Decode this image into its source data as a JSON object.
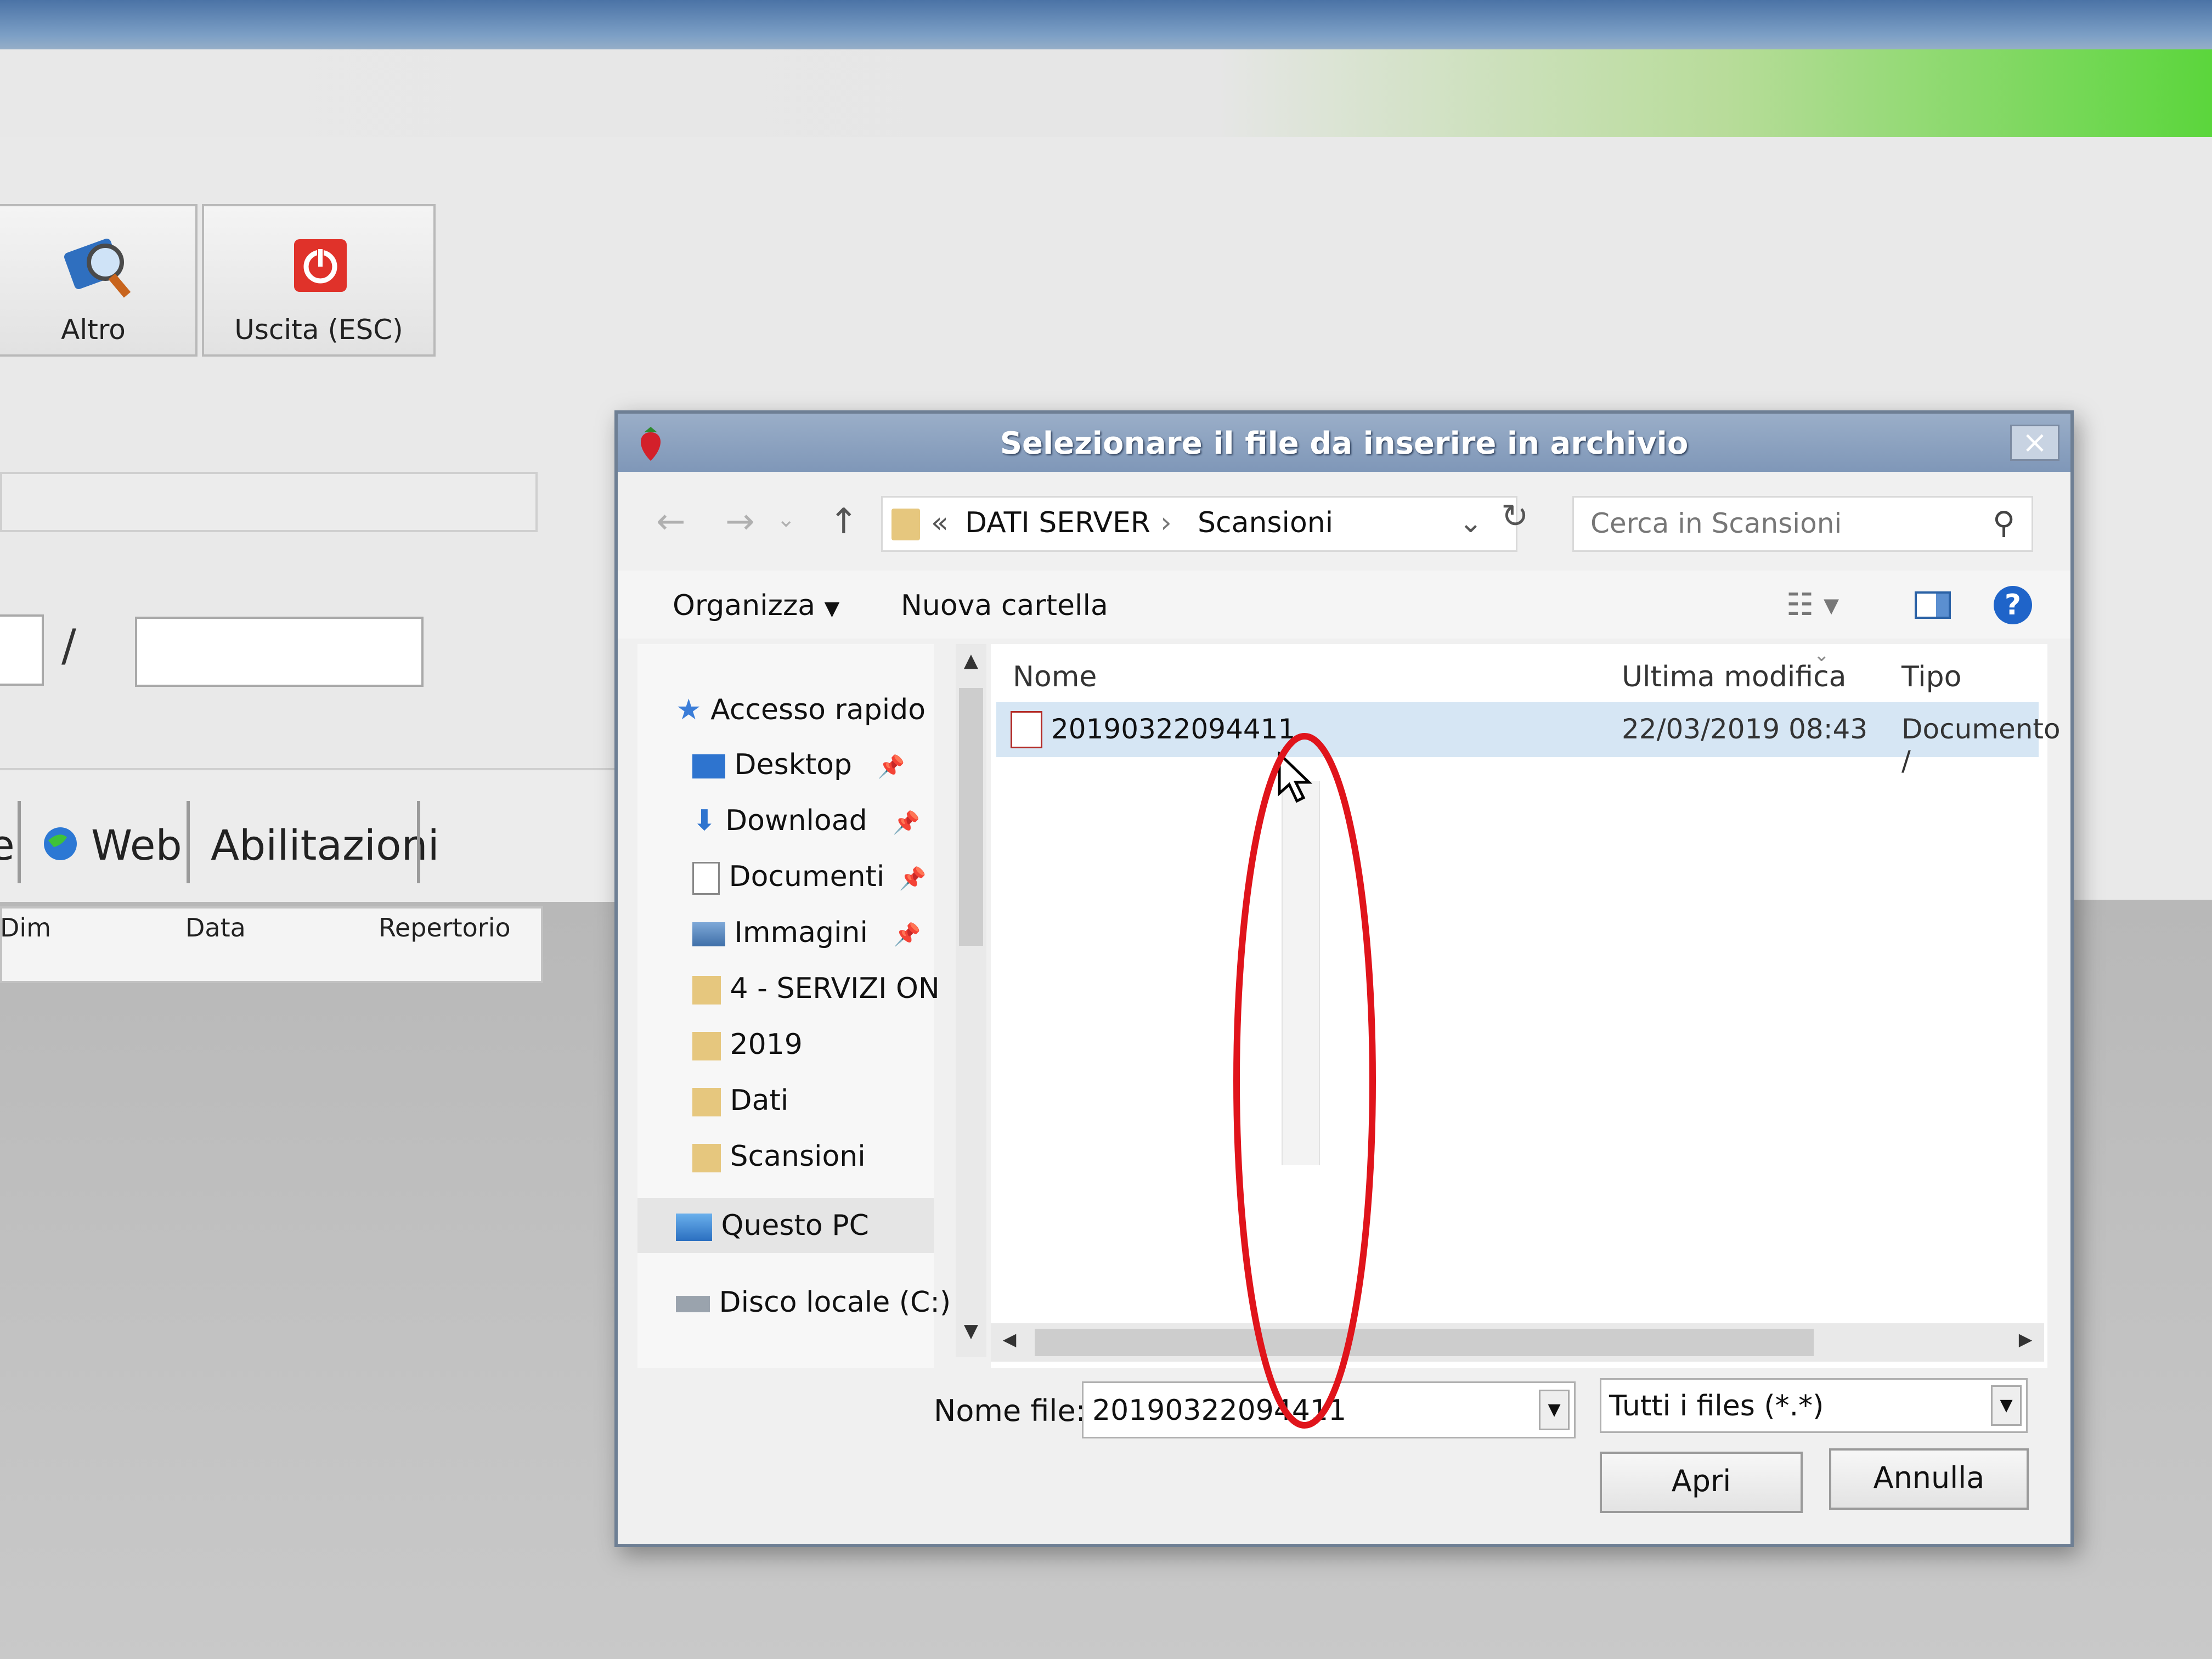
{
  "app": {
    "toolbar": [
      {
        "label": "Altro",
        "icon": "magnifier-book-icon"
      },
      {
        "label": "Uscita (ESC)",
        "icon": "power-icon"
      }
    ],
    "separator": "/",
    "tabs": {
      "partial": "e",
      "web": "Web",
      "abilitazioni": "Abilitazioni"
    },
    "columns": [
      "Dim",
      "Data",
      "Repertorio"
    ]
  },
  "dialog": {
    "title": "Selezionare il file da inserire in archivio",
    "close_label": "×",
    "address": {
      "prefix": "«",
      "crumbs": [
        "DATI SERVER",
        "Scansioni"
      ]
    },
    "search_placeholder": "Cerca in Scansioni",
    "commands": {
      "organize": "Organizza",
      "new_folder": "Nuova cartella"
    },
    "nav": {
      "quick_access": "Accesso rapido",
      "items": [
        "Desktop",
        "Download",
        "Documenti",
        "Immagini",
        "4 - SERVIZI ON",
        "2019",
        "Dati",
        "Scansioni"
      ],
      "this_pc": "Questo PC",
      "local_disk": "Disco locale (C:)"
    },
    "columns": {
      "name": "Nome",
      "modified": "Ultima modifica",
      "type": "Tipo"
    },
    "files": [
      {
        "name": "20190322094411",
        "modified": "22/03/2019 08:43",
        "type": "Documento /"
      }
    ],
    "filename_label": "Nome file:",
    "filename_value": "20190322094411",
    "filter": "Tutti i files (*.*)",
    "open_button": "Apri",
    "cancel_button": "Annulla",
    "help_label": "?"
  },
  "colors": {
    "annotation": "#e0141b",
    "selection": "#d6e6f4",
    "title_bar": "#8ea4c2"
  }
}
